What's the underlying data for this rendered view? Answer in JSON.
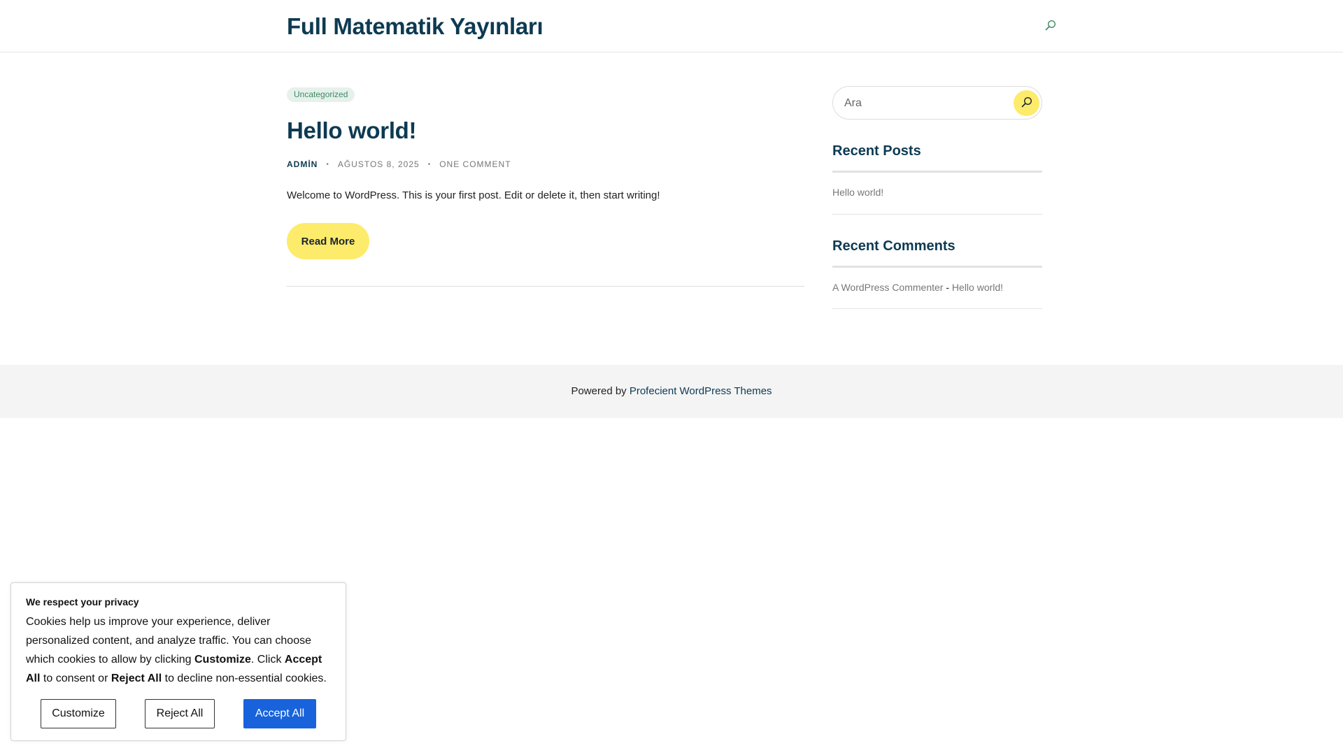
{
  "header": {
    "site_title": "Full Matematik Yayınları",
    "search_icon": "search-icon"
  },
  "post": {
    "category": "Uncategorized",
    "title": "Hello world!",
    "author": "ADMİN",
    "date": "AĞUSTOS 8, 2025",
    "comments": "ONE COMMENT",
    "excerpt": "Welcome to WordPress. This is your first post. Edit or delete it, then start writing!",
    "read_more": "Read More"
  },
  "sidebar": {
    "search_placeholder": "Ara",
    "search_button_icon": "search-icon",
    "recent_posts_title": "Recent Posts",
    "recent_posts": [
      "Hello world!"
    ],
    "recent_comments_title": "Recent Comments",
    "recent_comment": {
      "author": "A WordPress Commenter",
      "separator": " - ",
      "post": "Hello world!"
    }
  },
  "footer": {
    "prefix": "Powered by ",
    "link": "Profecient WordPress Themes"
  },
  "cookie": {
    "title": "We respect your privacy",
    "body_1": "Cookies help us improve your experience, deliver personalized content, and analyze traffic. You can choose which cookies to allow by clicking ",
    "body_customize": "Customize",
    "body_2": ". Click ",
    "body_accept": "Accept All",
    "body_3": " to consent or ",
    "body_reject": "Reject All",
    "body_4": " to decline non-essential cookies.",
    "customize_label": "Customize",
    "reject_label": "Reject All",
    "accept_label": "Accept All"
  },
  "colors": {
    "brand_dark": "#0d3a52",
    "accent_yellow": "#fdeb6b",
    "cookie_primary": "#1863dc",
    "badge_bg": "#e6f1ec",
    "badge_text": "#3f8a62"
  }
}
